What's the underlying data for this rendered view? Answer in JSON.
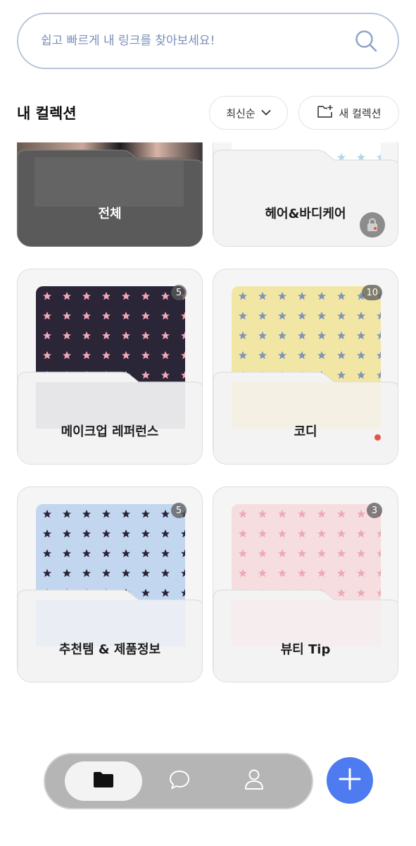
{
  "search": {
    "placeholder": "쉽고 빠르게 내 링크를 찾아보세요!",
    "icon": "search-icon"
  },
  "header": {
    "title": "내 컬렉션",
    "sort_label": "최신순",
    "new_label": "새 컬렉션"
  },
  "collections": [
    {
      "name": "전체",
      "cover": "portrait-photo",
      "count": ""
    },
    {
      "name": "헤어&바디케어",
      "cover": "white-stars",
      "count": "",
      "locked": true
    },
    {
      "name": "메이크업 레퍼런스",
      "cover": "navy-pink-stars",
      "count": "5"
    },
    {
      "name": "코디",
      "cover": "yellow-blue-stars",
      "count": "10",
      "new_dot": true
    },
    {
      "name": "추천템 & 제품정보",
      "cover": "blue-navy-stars",
      "count": "5"
    },
    {
      "name": "뷰티 Tip",
      "cover": "pink-pink-stars",
      "count": "3"
    }
  ],
  "colors": {
    "accent": "#4f7bf0",
    "new_dot": "#e5534b",
    "search_border": "#b9c4dc"
  },
  "nav": {
    "tabs": [
      "folder-icon",
      "chat-icon",
      "profile-icon"
    ],
    "active": "folder-icon",
    "fab_icon": "plus-icon"
  }
}
